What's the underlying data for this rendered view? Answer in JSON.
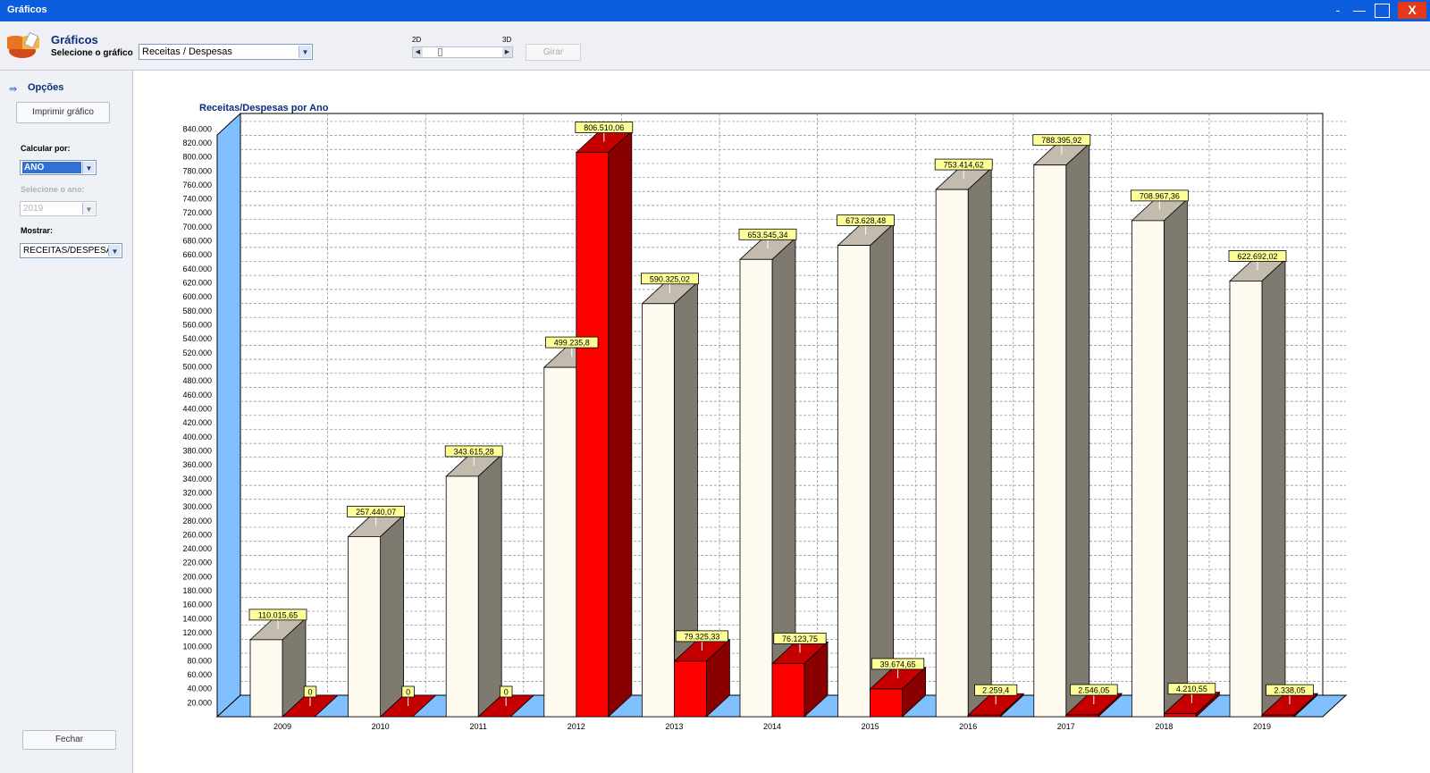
{
  "window": {
    "title": "Gráficos",
    "minimize_glyph": "-",
    "restore_glyph": "—",
    "close_label": "X",
    "user_icon": "user-icon"
  },
  "header": {
    "app_title": "Gráficos",
    "subtitle": "Selecione o gráfico",
    "chart_select_value": "Receitas / Despesas",
    "label_2d": "2D",
    "label_3d": "3D",
    "rotate_button": "Girar",
    "logo_icon": "chart-logo-icon",
    "slider_left_glyph": "◀",
    "slider_right_glyph": "▶"
  },
  "sidebar": {
    "section_title": "Opções",
    "section_icon": "double-arrow-icon",
    "print_button": "Imprimir gráfico",
    "calc_label": "Calcular por:",
    "calc_value": "ANO",
    "year_label": "Selecione o ano:",
    "year_value": "2019",
    "show_label": "Mostrar:",
    "show_value": "RECEITAS/DESPESAS",
    "close_button": "Fechar",
    "dropdown_glyph": "▼"
  },
  "chart_data": {
    "type": "bar",
    "title": "Receitas/Despesas por Ano",
    "categories": [
      "2009",
      "2010",
      "2011",
      "2012",
      "2013",
      "2014",
      "2015",
      "2016",
      "2017",
      "2018",
      "2019"
    ],
    "series": [
      {
        "values": [
          110015.65,
          257440.07,
          343615.28,
          499235.8,
          590325.02,
          653545.34,
          673628.48,
          753414.62,
          788395.92,
          708967.36,
          622692.02
        ],
        "labels": [
          "110.015,65",
          "257.440,07",
          "343.615,28",
          "499.235,8",
          "590.325,02",
          "653.545,34",
          "673.628,48",
          "753.414,62",
          "788.395,92",
          "708.967,36",
          "622.692,02"
        ]
      },
      {
        "values": [
          0,
          0,
          0,
          806510.06,
          79325.33,
          76123.75,
          39674.65,
          2259.4,
          2546.05,
          4210.55,
          2338.05
        ],
        "labels": [
          "0",
          "0",
          "0",
          "806.510,06",
          "79.325,33",
          "76.123,75",
          "39.674,65",
          "2.259,4",
          "2.546,05",
          "4.210,55",
          "2.338,05"
        ]
      }
    ],
    "y_ticks": [
      20000,
      40000,
      60000,
      80000,
      100000,
      120000,
      140000,
      160000,
      180000,
      200000,
      220000,
      240000,
      260000,
      280000,
      300000,
      320000,
      340000,
      360000,
      380000,
      400000,
      420000,
      440000,
      460000,
      480000,
      500000,
      520000,
      540000,
      560000,
      580000,
      600000,
      620000,
      640000,
      660000,
      680000,
      700000,
      720000,
      740000,
      760000,
      780000,
      800000,
      820000,
      840000
    ],
    "y_tick_labels": [
      "20.000",
      "40.000",
      "60.000",
      "80.000",
      "100.000",
      "120.000",
      "140.000",
      "160.000",
      "180.000",
      "200.000",
      "220.000",
      "240.000",
      "260.000",
      "280.000",
      "300.000",
      "320.000",
      "340.000",
      "360.000",
      "380.000",
      "400.000",
      "420.000",
      "440.000",
      "460.000",
      "480.000",
      "500.000",
      "520.000",
      "540.000",
      "560.000",
      "580.000",
      "600.000",
      "620.000",
      "640.000",
      "660.000",
      "680.000",
      "700.000",
      "720.000",
      "740.000",
      "760.000",
      "780.000",
      "800.000",
      "820.000",
      "840.000"
    ],
    "ylim": [
      0,
      860000
    ],
    "grid": true,
    "legend": "none",
    "colors": {
      "receitas_front": "#fefaf0",
      "receitas_side": "#7f7a70",
      "receitas_top": "#c2bbae",
      "despesas_front": "#ff0000",
      "despesas_side": "#880000",
      "despesas_top": "#c40000",
      "wall": "#80c0ff",
      "label_bg": "#ffff99",
      "title": "#0b2d7a"
    }
  }
}
